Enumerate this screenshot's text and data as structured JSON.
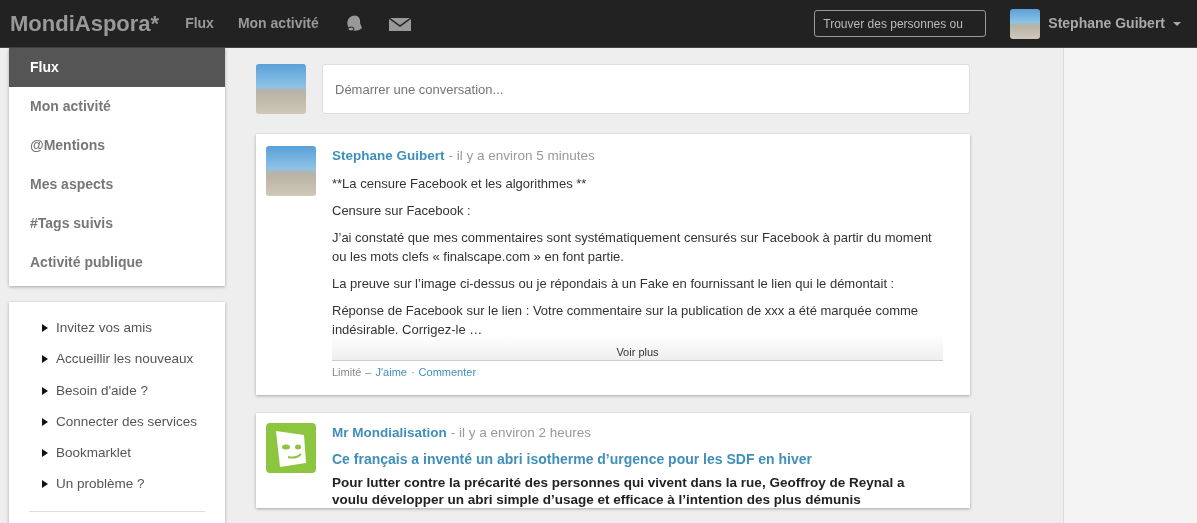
{
  "navbar": {
    "brand": "MondiAspora*",
    "links": [
      {
        "label": "Flux"
      },
      {
        "label": "Mon activité"
      }
    ],
    "search": {
      "placeholder": "Trouver des personnes ou"
    },
    "user": {
      "name": "Stephane Guibert"
    }
  },
  "sidebar": {
    "items": [
      {
        "label": "Flux",
        "selected": true
      },
      {
        "label": "Mon activité",
        "selected": false
      },
      {
        "label": "@Mentions",
        "selected": false
      },
      {
        "label": "Mes aspects",
        "selected": false
      },
      {
        "label": "#Tags suivis",
        "selected": false
      },
      {
        "label": "Activité publique",
        "selected": false
      }
    ],
    "links": [
      "Invitez vos amis",
      "Accueillir les nouveaux",
      "Besoin d'aide ?",
      "Connecter des services",
      "Bookmarklet",
      "Un problème ?"
    ]
  },
  "composer": {
    "placeholder": "Démarrer une conversation..."
  },
  "posts": [
    {
      "kind": "text",
      "author": "Stephane Guibert",
      "time": "- il y a environ 5 minutes",
      "paragraphs": [
        "**La censure Facebook et les algorithmes **",
        "Censure sur Facebook :",
        "J’ai constaté que mes commentaires sont systématiquement censurés sur Facebook à partir du moment ou les mots clefs « finalscape.com » en font partie.",
        "La preuve sur l’image ci-dessus ou je répondais à un Fake en fournissant le lien qui le démontait :",
        "Réponse de Facebook sur le lien : Votre commentaire sur la publication de xxx a été marquée comme indésirable. Corrigez-le …"
      ],
      "more": "Voir plus",
      "visibility": "Limité",
      "separators": [
        "–",
        "·"
      ],
      "actions": [
        "J'aime",
        "Commenter"
      ]
    },
    {
      "kind": "article",
      "author": "Mr Mondialisation",
      "time": "- il y a environ 2 heures",
      "title": "Ce français a inventé un abri isotherme d’urgence pour les SDF en hiver",
      "paragraphs": [
        "Pour lutter contre la précarité des personnes qui vivent dans la rue, Geoffroy de Reynal a voulu développer un abri simple d’usage et efficace à l’intention des plus démunis"
      ]
    }
  ]
}
